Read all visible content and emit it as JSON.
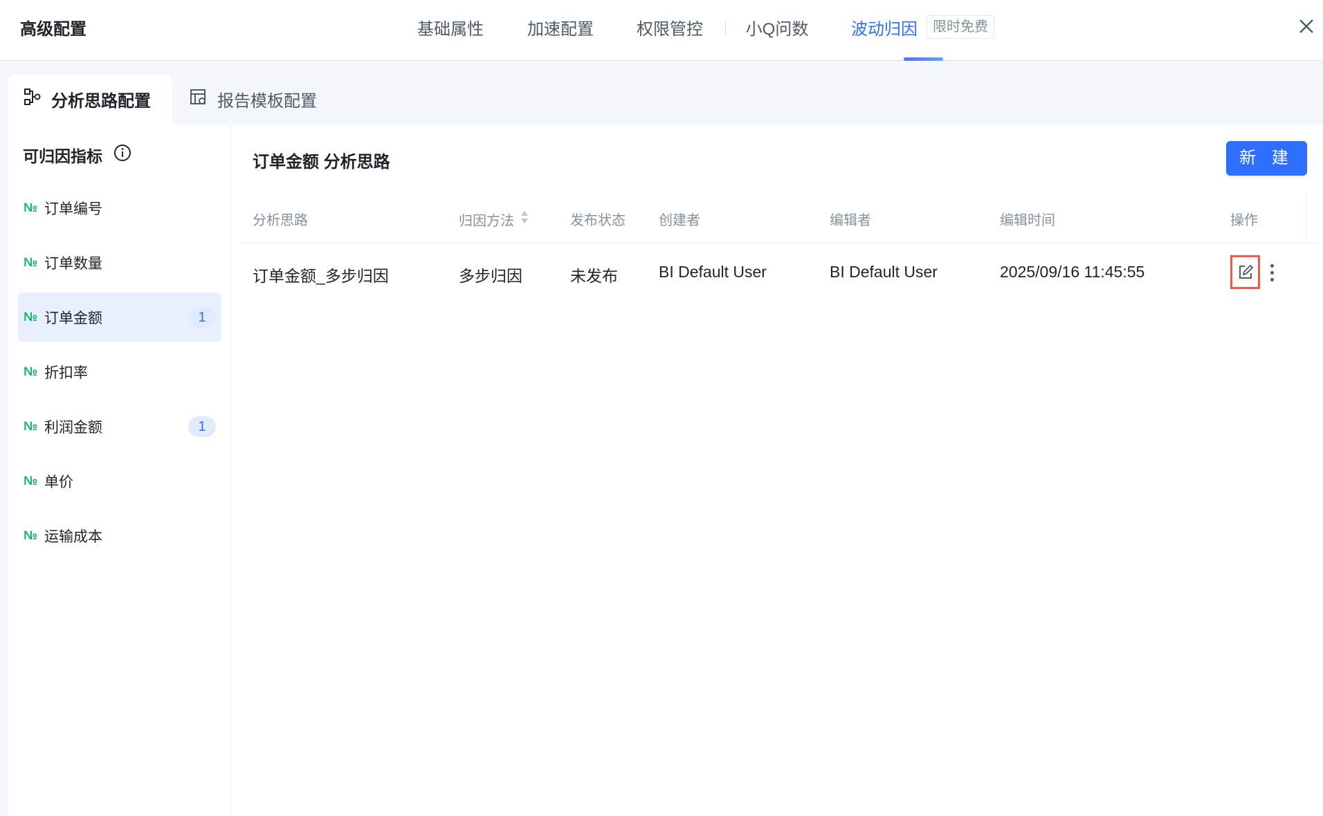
{
  "header": {
    "title": "高级配置",
    "tabs": [
      "基础属性",
      "加速配置",
      "权限管控",
      "小Q问数",
      "波动归因"
    ],
    "badge": "限时免费"
  },
  "subtabs": [
    "分析思路配置",
    "报告模板配置"
  ],
  "sidebar": {
    "title": "可归因指标",
    "items": [
      {
        "label": "订单编号",
        "count": null
      },
      {
        "label": "订单数量",
        "count": null
      },
      {
        "label": "订单金额",
        "count": "1"
      },
      {
        "label": "折扣率",
        "count": null
      },
      {
        "label": "利润金额",
        "count": "1"
      },
      {
        "label": "单价",
        "count": null
      },
      {
        "label": "运输成本",
        "count": null
      }
    ],
    "no_symbol": "№"
  },
  "main": {
    "title": "订单金额 分析思路",
    "new_button": "新 建",
    "columns": [
      "分析思路",
      "归因方法",
      "发布状态",
      "创建者",
      "编辑者",
      "编辑时间",
      "操作"
    ],
    "rows": [
      {
        "name": "订单金额_多步归因",
        "method": "多步归因",
        "status": "未发布",
        "creator": "BI Default User",
        "editor": "BI Default User",
        "time": "2025/09/16 11:45:55"
      }
    ]
  },
  "colors": {
    "accent": "#2e6fff",
    "highlight": "#f05a4a",
    "metric_icon": "#13b56b"
  }
}
